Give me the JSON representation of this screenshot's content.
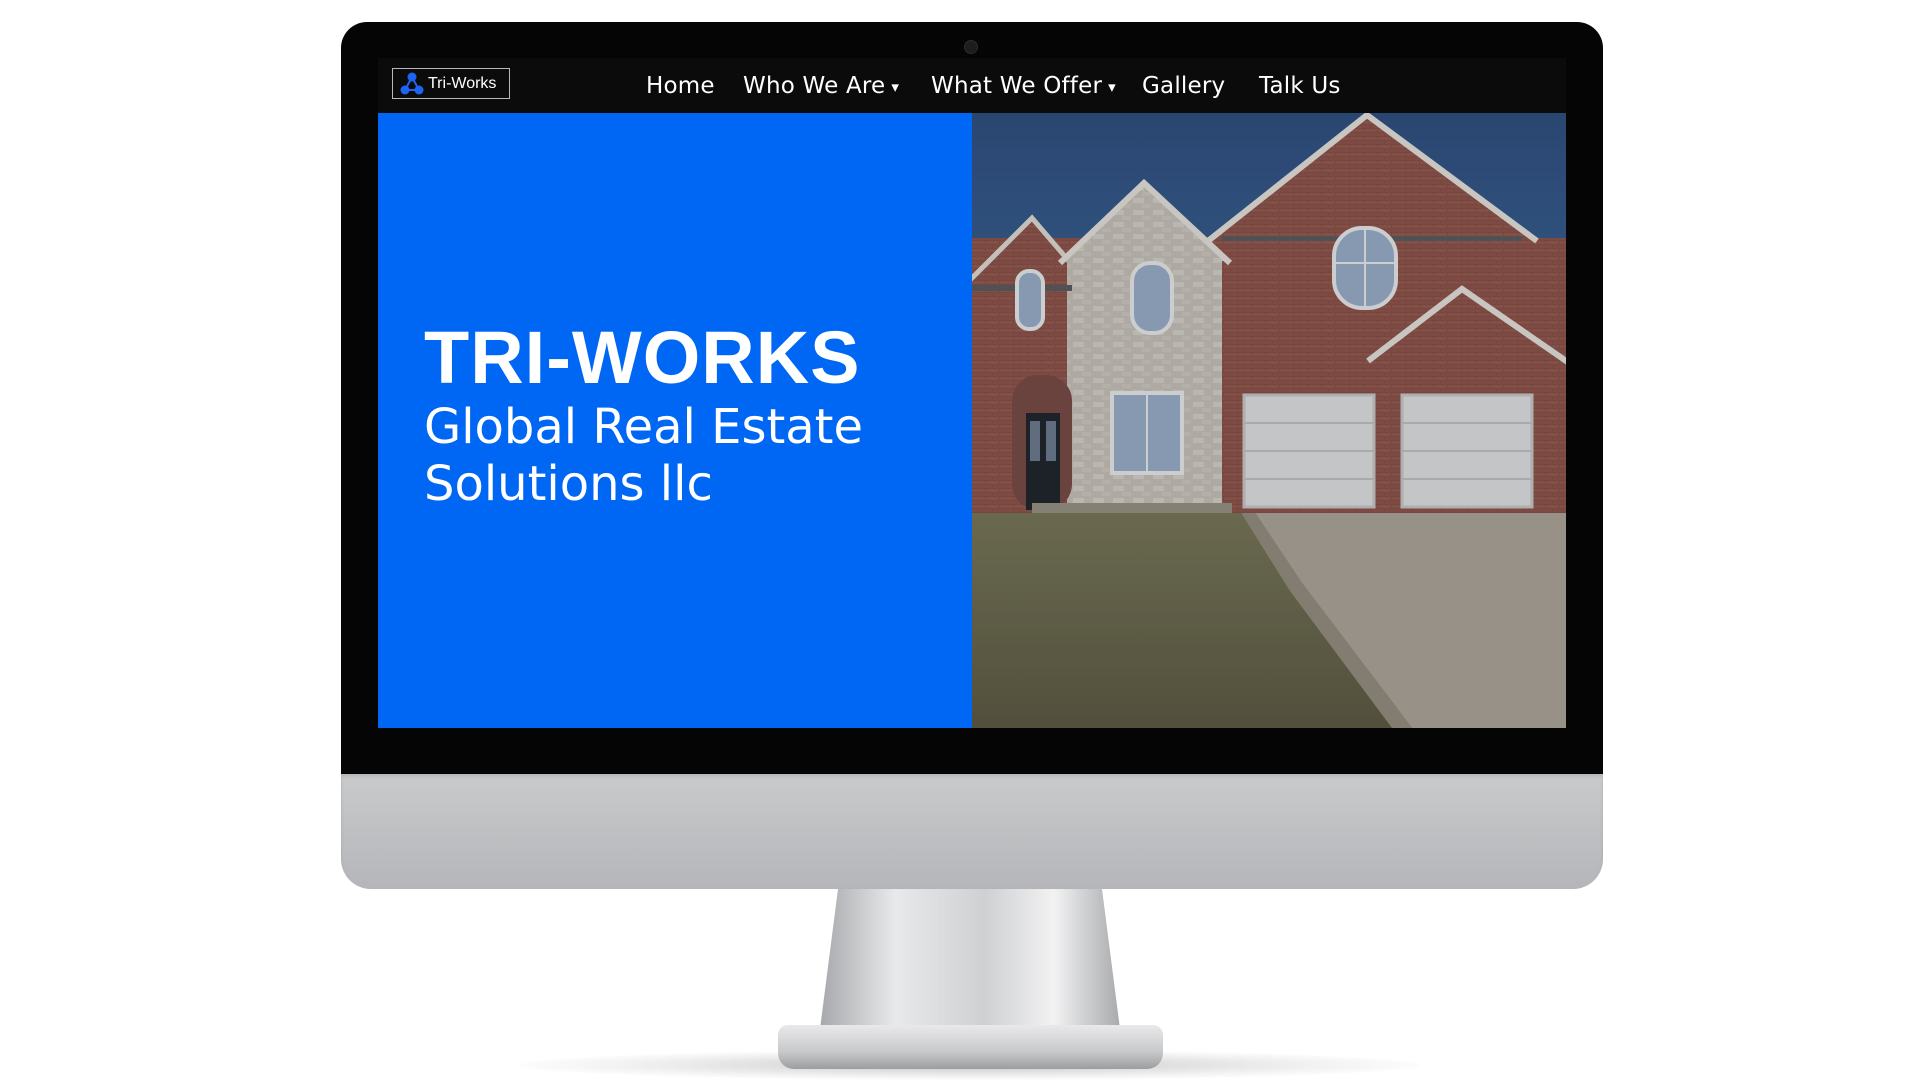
{
  "brand": {
    "logo_text": "Tri-Works"
  },
  "nav": {
    "items": [
      {
        "label": "Home",
        "has_dropdown": false
      },
      {
        "label": "Who We Are",
        "has_dropdown": true
      },
      {
        "label": "What We Offer",
        "has_dropdown": true
      },
      {
        "label": "Gallery",
        "has_dropdown": false
      },
      {
        "label": "Talk Us",
        "has_dropdown": false
      }
    ],
    "dropdown_glyph": "▾"
  },
  "hero": {
    "title": "TRI-WORKS",
    "subtitle": "Global Real Estate Solutions llc",
    "image_icon": "house-photo"
  },
  "colors": {
    "accent_blue": "#0066f4",
    "navbar_bg": "#0b0b0b",
    "text_white": "#ffffff"
  }
}
